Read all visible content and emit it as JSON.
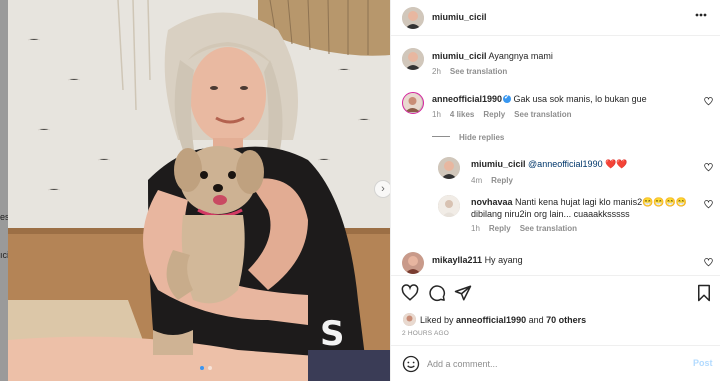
{
  "backdrop": {
    "fragments": [
      "es",
      "ıci"
    ]
  },
  "post": {
    "author": "miumiu_cicil",
    "caption": {
      "username": "miumiu_cicil",
      "text": "Ayangnya mami",
      "age": "2h",
      "see_translation": "See translation"
    }
  },
  "comments": [
    {
      "username": "anneofficial1990",
      "verified": true,
      "text": "Gak usa sok manis, lo bukan gue",
      "age": "1h",
      "likes": "4 likes",
      "reply": "Reply",
      "see_translation": "See translation",
      "hide_replies": "Hide replies",
      "replies": [
        {
          "username": "miumiu_cicil",
          "text": "@anneofficial1990 ❤️❤️",
          "age": "4m",
          "reply": "Reply"
        },
        {
          "username": "novhavaa",
          "text_line1": "Nanti kena hujat lagi klo manis2😁😁😁😁",
          "text_line2": "dibilang niru2in org lain... cuaaakksssss",
          "age": "1h",
          "reply": "Reply",
          "see_translation": "See translation"
        }
      ]
    },
    {
      "username": "mikaylla211",
      "text": "Hy ayang"
    }
  ],
  "liked_by": {
    "prefix": "Liked by",
    "user": "anneofficial1990",
    "and": "and",
    "others": "70 others"
  },
  "timestamp": "2 HOURS AGO",
  "add_comment": {
    "placeholder": "Add a comment...",
    "post_label": "Post"
  },
  "icons": {
    "more": "more-options-icon",
    "emoji": "emoji-icon",
    "like": "heart-icon",
    "comment": "comment-icon",
    "share": "share-icon",
    "save": "bookmark-icon",
    "next": "chevron-right-icon"
  },
  "colors": {
    "verified": "#3897f0",
    "post_button": "#b3dbff",
    "link": "#00376b"
  }
}
